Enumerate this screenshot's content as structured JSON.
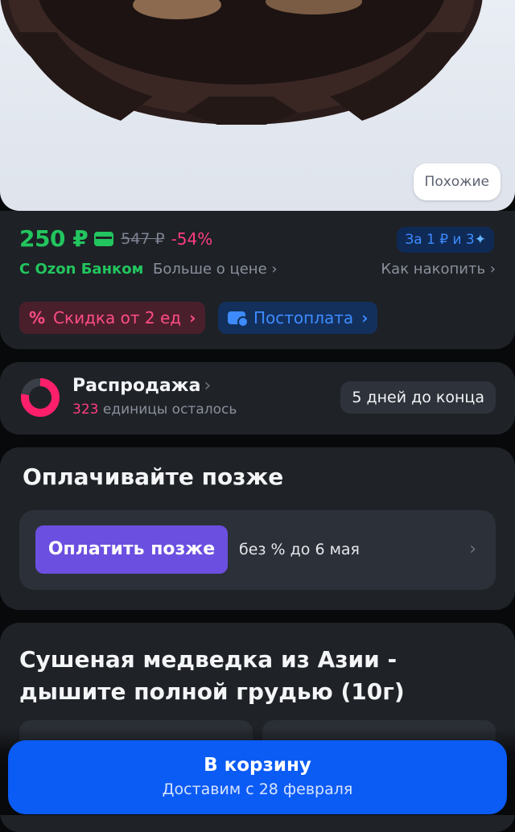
{
  "hero": {
    "similar_label": "Похожие"
  },
  "price": {
    "current": "250 ₽",
    "old": "547 ₽",
    "discount": "-54%",
    "bank_label": "С Ozon Банком",
    "more_label": "Больше о цене",
    "bonus_text": "За 1 ₽ и 3",
    "bonus_star": "✦",
    "how_save_label": "Как накопить",
    "colors": {
      "green": "#22c55e",
      "pink": "#ff3d7f",
      "blue": "#3d8bff"
    }
  },
  "chips": {
    "discount_icon": "%",
    "discount_label": "Скидка от 2 ед",
    "postpay_label": "Постоплата"
  },
  "sale": {
    "title": "Распродажа",
    "count": "323",
    "remaining_label": "единицы осталось",
    "days_left": "5 дней до конца",
    "progress_fraction": 0.78
  },
  "pay_later": {
    "title": "Оплачивайте позже",
    "button": "Оплатить позже",
    "terms": "без % до 6 мая"
  },
  "product": {
    "title_line1": "Сушеная медведка из Азии -",
    "title_line2": "дышите полной грудью (10г)"
  },
  "cart": {
    "button": "В корзину",
    "delivery": "Доставим с 28 февраля",
    "color": "#0b5bf5"
  },
  "icons": {
    "chevron": "›",
    "card": "card-icon",
    "wallet": "wallet-icon",
    "ring": "progress-ring-icon"
  }
}
